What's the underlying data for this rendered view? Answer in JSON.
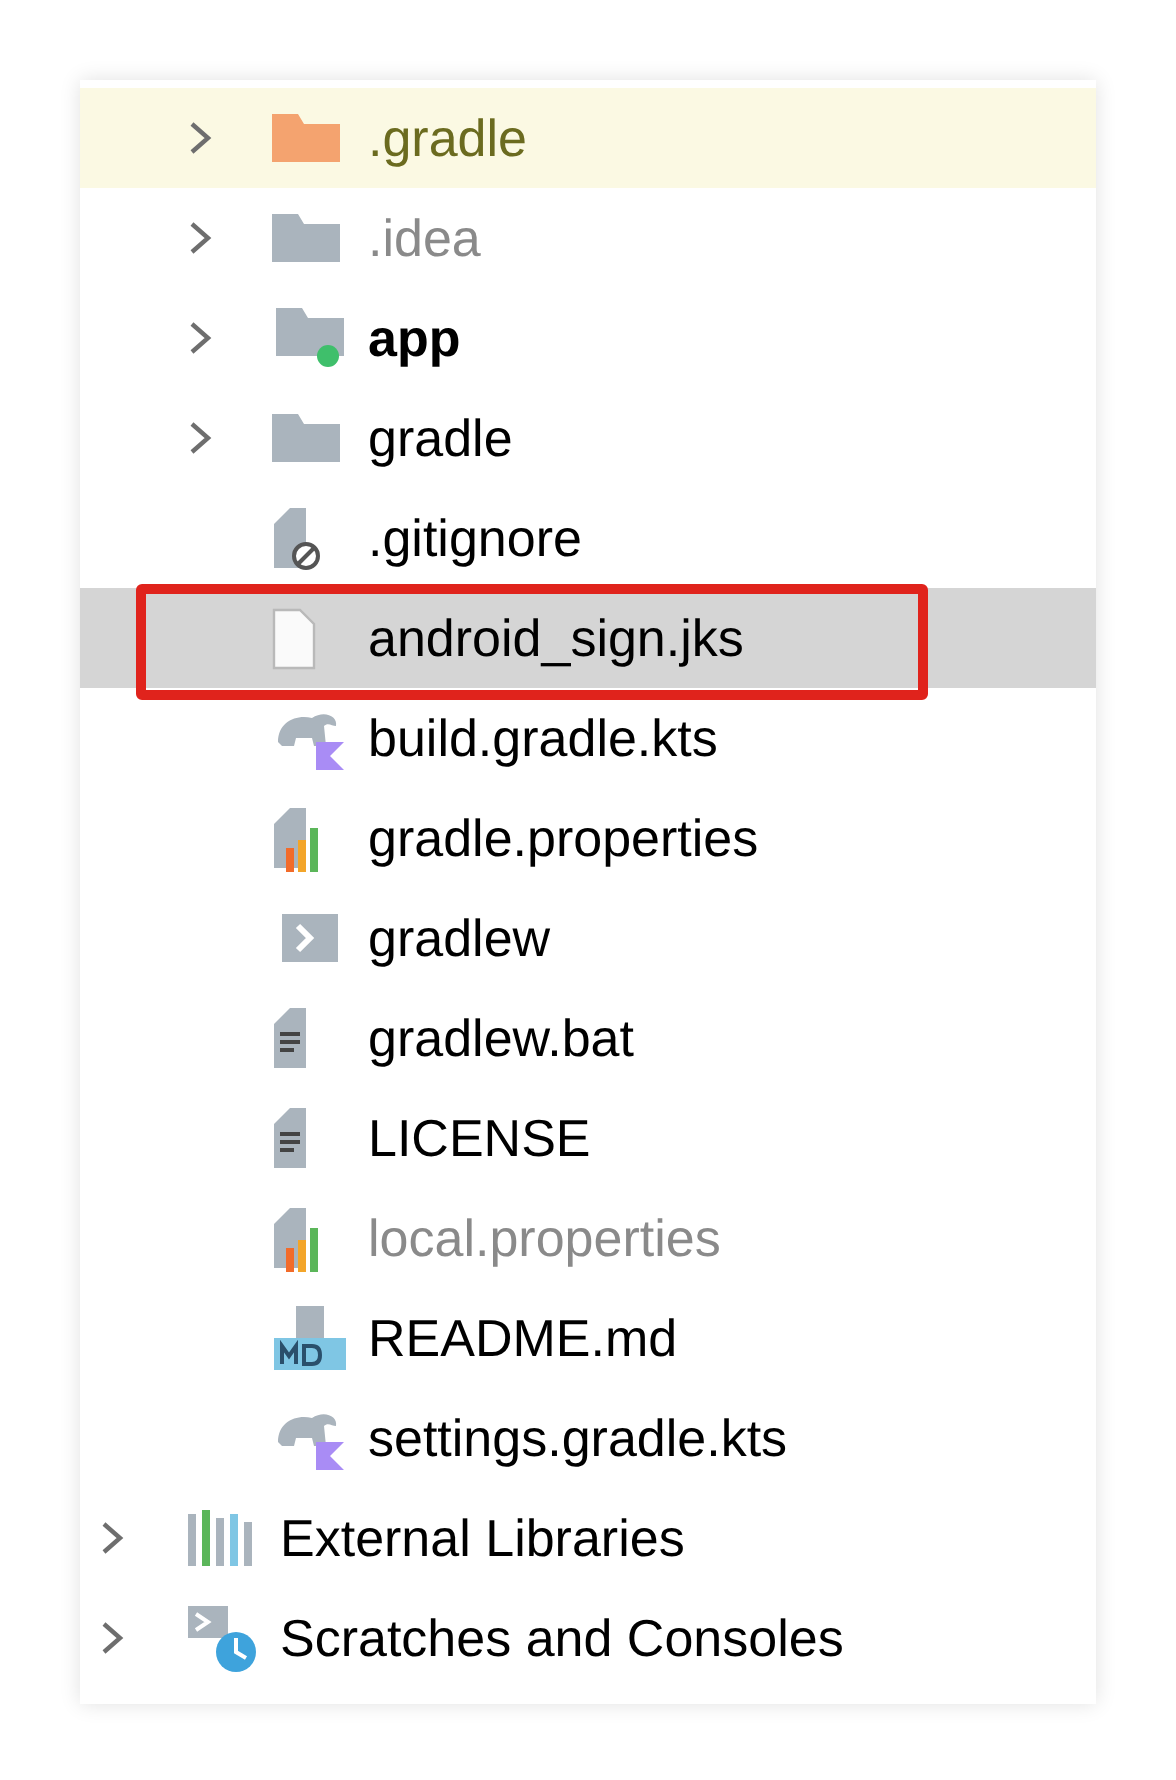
{
  "project_children": [
    {
      "label": ".gradle",
      "kind": "folder",
      "excluded": true,
      "expanded": false,
      "selected": false,
      "annotated": false
    },
    {
      "label": ".idea",
      "kind": "folder",
      "excluded": false,
      "muted": true,
      "expanded": false,
      "selected": false,
      "annotated": false
    },
    {
      "label": "app",
      "kind": "module",
      "excluded": false,
      "muted": false,
      "expanded": false,
      "selected": false,
      "annotated": false
    },
    {
      "label": "gradle",
      "kind": "folder",
      "excluded": false,
      "muted": false,
      "expanded": false,
      "selected": false,
      "annotated": false
    },
    {
      "label": ".gitignore",
      "kind": "ignore",
      "excluded": false,
      "muted": false,
      "selected": false,
      "annotated": false
    },
    {
      "label": "android_sign.jks",
      "kind": "blank",
      "excluded": false,
      "muted": false,
      "selected": true,
      "annotated": true
    },
    {
      "label": "build.gradle.kts",
      "kind": "gradle",
      "excluded": false,
      "muted": false,
      "selected": false,
      "annotated": false
    },
    {
      "label": "gradle.properties",
      "kind": "properties",
      "excluded": false,
      "muted": false,
      "selected": false,
      "annotated": false
    },
    {
      "label": "gradlew",
      "kind": "shell",
      "excluded": false,
      "muted": false,
      "selected": false,
      "annotated": false
    },
    {
      "label": "gradlew.bat",
      "kind": "text",
      "excluded": false,
      "muted": false,
      "selected": false,
      "annotated": false
    },
    {
      "label": "LICENSE",
      "kind": "text",
      "excluded": false,
      "muted": false,
      "selected": false,
      "annotated": false
    },
    {
      "label": "local.properties",
      "kind": "properties",
      "excluded": false,
      "muted": true,
      "selected": false,
      "annotated": false
    },
    {
      "label": "README.md",
      "kind": "markdown",
      "excluded": false,
      "muted": false,
      "selected": false,
      "annotated": false
    },
    {
      "label": "settings.gradle.kts",
      "kind": "gradle",
      "excluded": false,
      "muted": false,
      "selected": false,
      "annotated": false
    }
  ],
  "top_level_nodes": [
    {
      "label": "External Libraries",
      "kind": "libraries",
      "excluded": false,
      "muted": false,
      "expanded": false,
      "selected": false,
      "annotated": false
    },
    {
      "label": "Scratches and Consoles",
      "kind": "scratches",
      "excluded": false,
      "muted": false,
      "expanded": false,
      "selected": false,
      "annotated": false
    }
  ]
}
